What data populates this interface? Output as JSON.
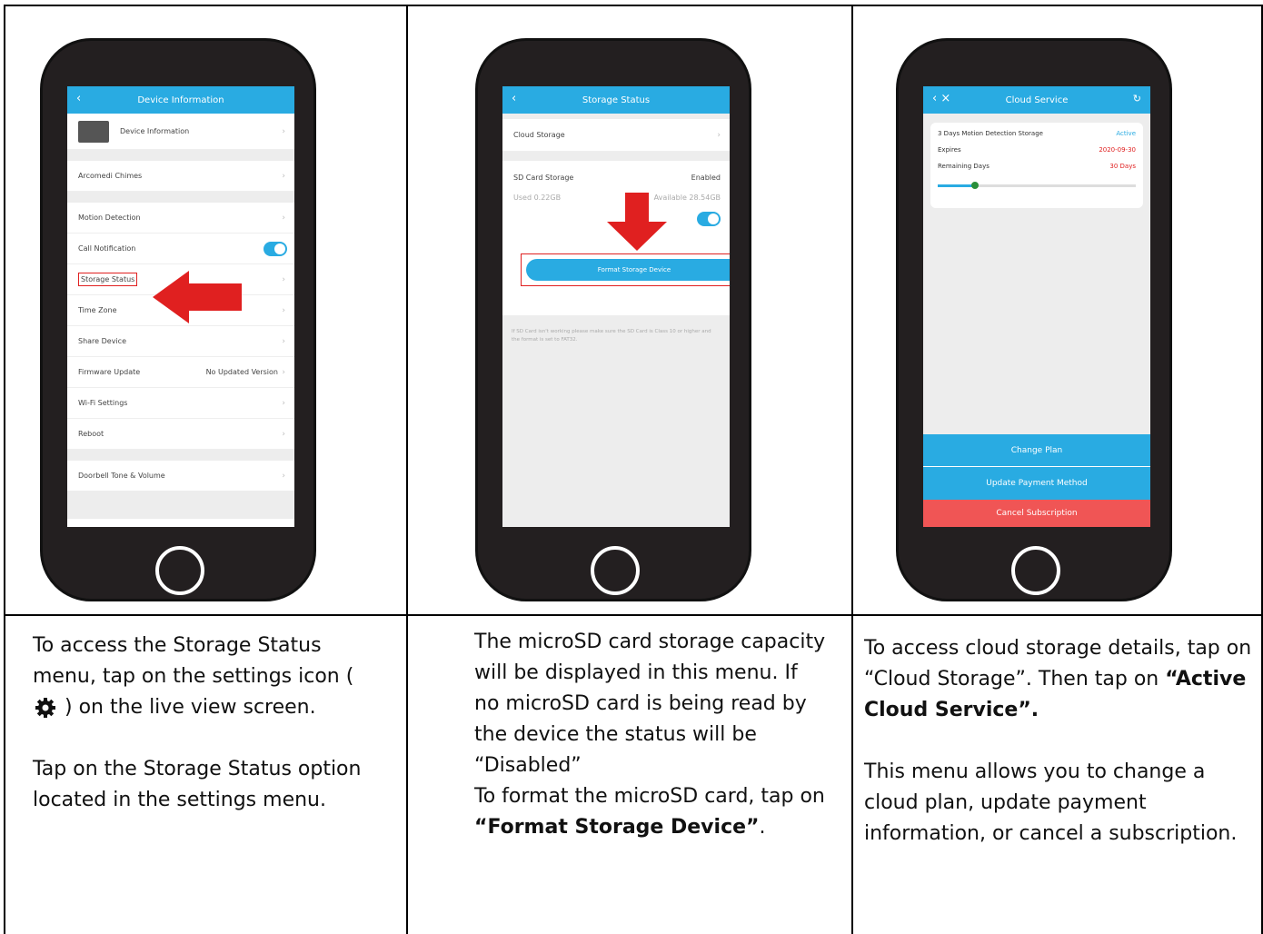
{
  "panel1": {
    "screen": {
      "title": "Device Information",
      "rows": [
        {
          "label": "Device Information"
        },
        {
          "label": "Arcomedi Chimes"
        },
        {
          "label": "Motion Detection"
        },
        {
          "label": "Call Notification"
        },
        {
          "label": "Storage Status"
        },
        {
          "label": "Time Zone"
        },
        {
          "label": "Share Device"
        },
        {
          "label": "Firmware Update",
          "value": "No Updated Version"
        },
        {
          "label": "Wi-Fi Settings"
        },
        {
          "label": "Reboot"
        },
        {
          "label": "Doorbell Tone & Volume"
        }
      ]
    },
    "caption": {
      "p1_before": "To access the Storage Status menu, tap on the settings icon (",
      "p1_after": ") on the live view screen.",
      "p2": "Tap on the Storage Status option located in the settings menu."
    }
  },
  "panel2": {
    "screen": {
      "title": "Storage Status",
      "cloud": "Cloud Storage",
      "sd_label": "SD Card Storage",
      "sd_status": "Enabled",
      "used": "Used 0.22GB",
      "available": "Available 28.54GB",
      "format_btn": "Format Storage Device",
      "note": "If SD Card isn't working please make sure the SD Card is Class 10 or higher and the format is set to FAT32."
    },
    "caption": {
      "text": "The microSD card storage capacity will be displayed in this menu. If no microSD card is being read by the device the status will be “Disabled”",
      "format_before": "To format the microSD card, tap on ",
      "format_bold": "“Format Storage Device”",
      "format_after": "."
    }
  },
  "panel3": {
    "screen": {
      "title": "Cloud Service",
      "plan": "3 Days Motion Detection Storage",
      "plan_status": "Active",
      "expires": "Expires",
      "expires_val": "2020-09-30",
      "remaining": "Remaining Days",
      "remaining_val": "30 Days",
      "btn_change": "Change Plan",
      "btn_update": "Update Payment Method",
      "btn_cancel": "Cancel Subscription"
    },
    "caption": {
      "p1_before": "To access cloud storage details, tap on “Cloud Storage”. Then tap on ",
      "p1_bold": "“Active Cloud Service”.",
      "p2": "This menu allows you to change a cloud plan, update payment information, or cancel a subscription."
    }
  },
  "colors": {
    "accent": "#29abe2",
    "alert": "#e02020",
    "cancel": "#f05555",
    "phone": "#231f20"
  }
}
